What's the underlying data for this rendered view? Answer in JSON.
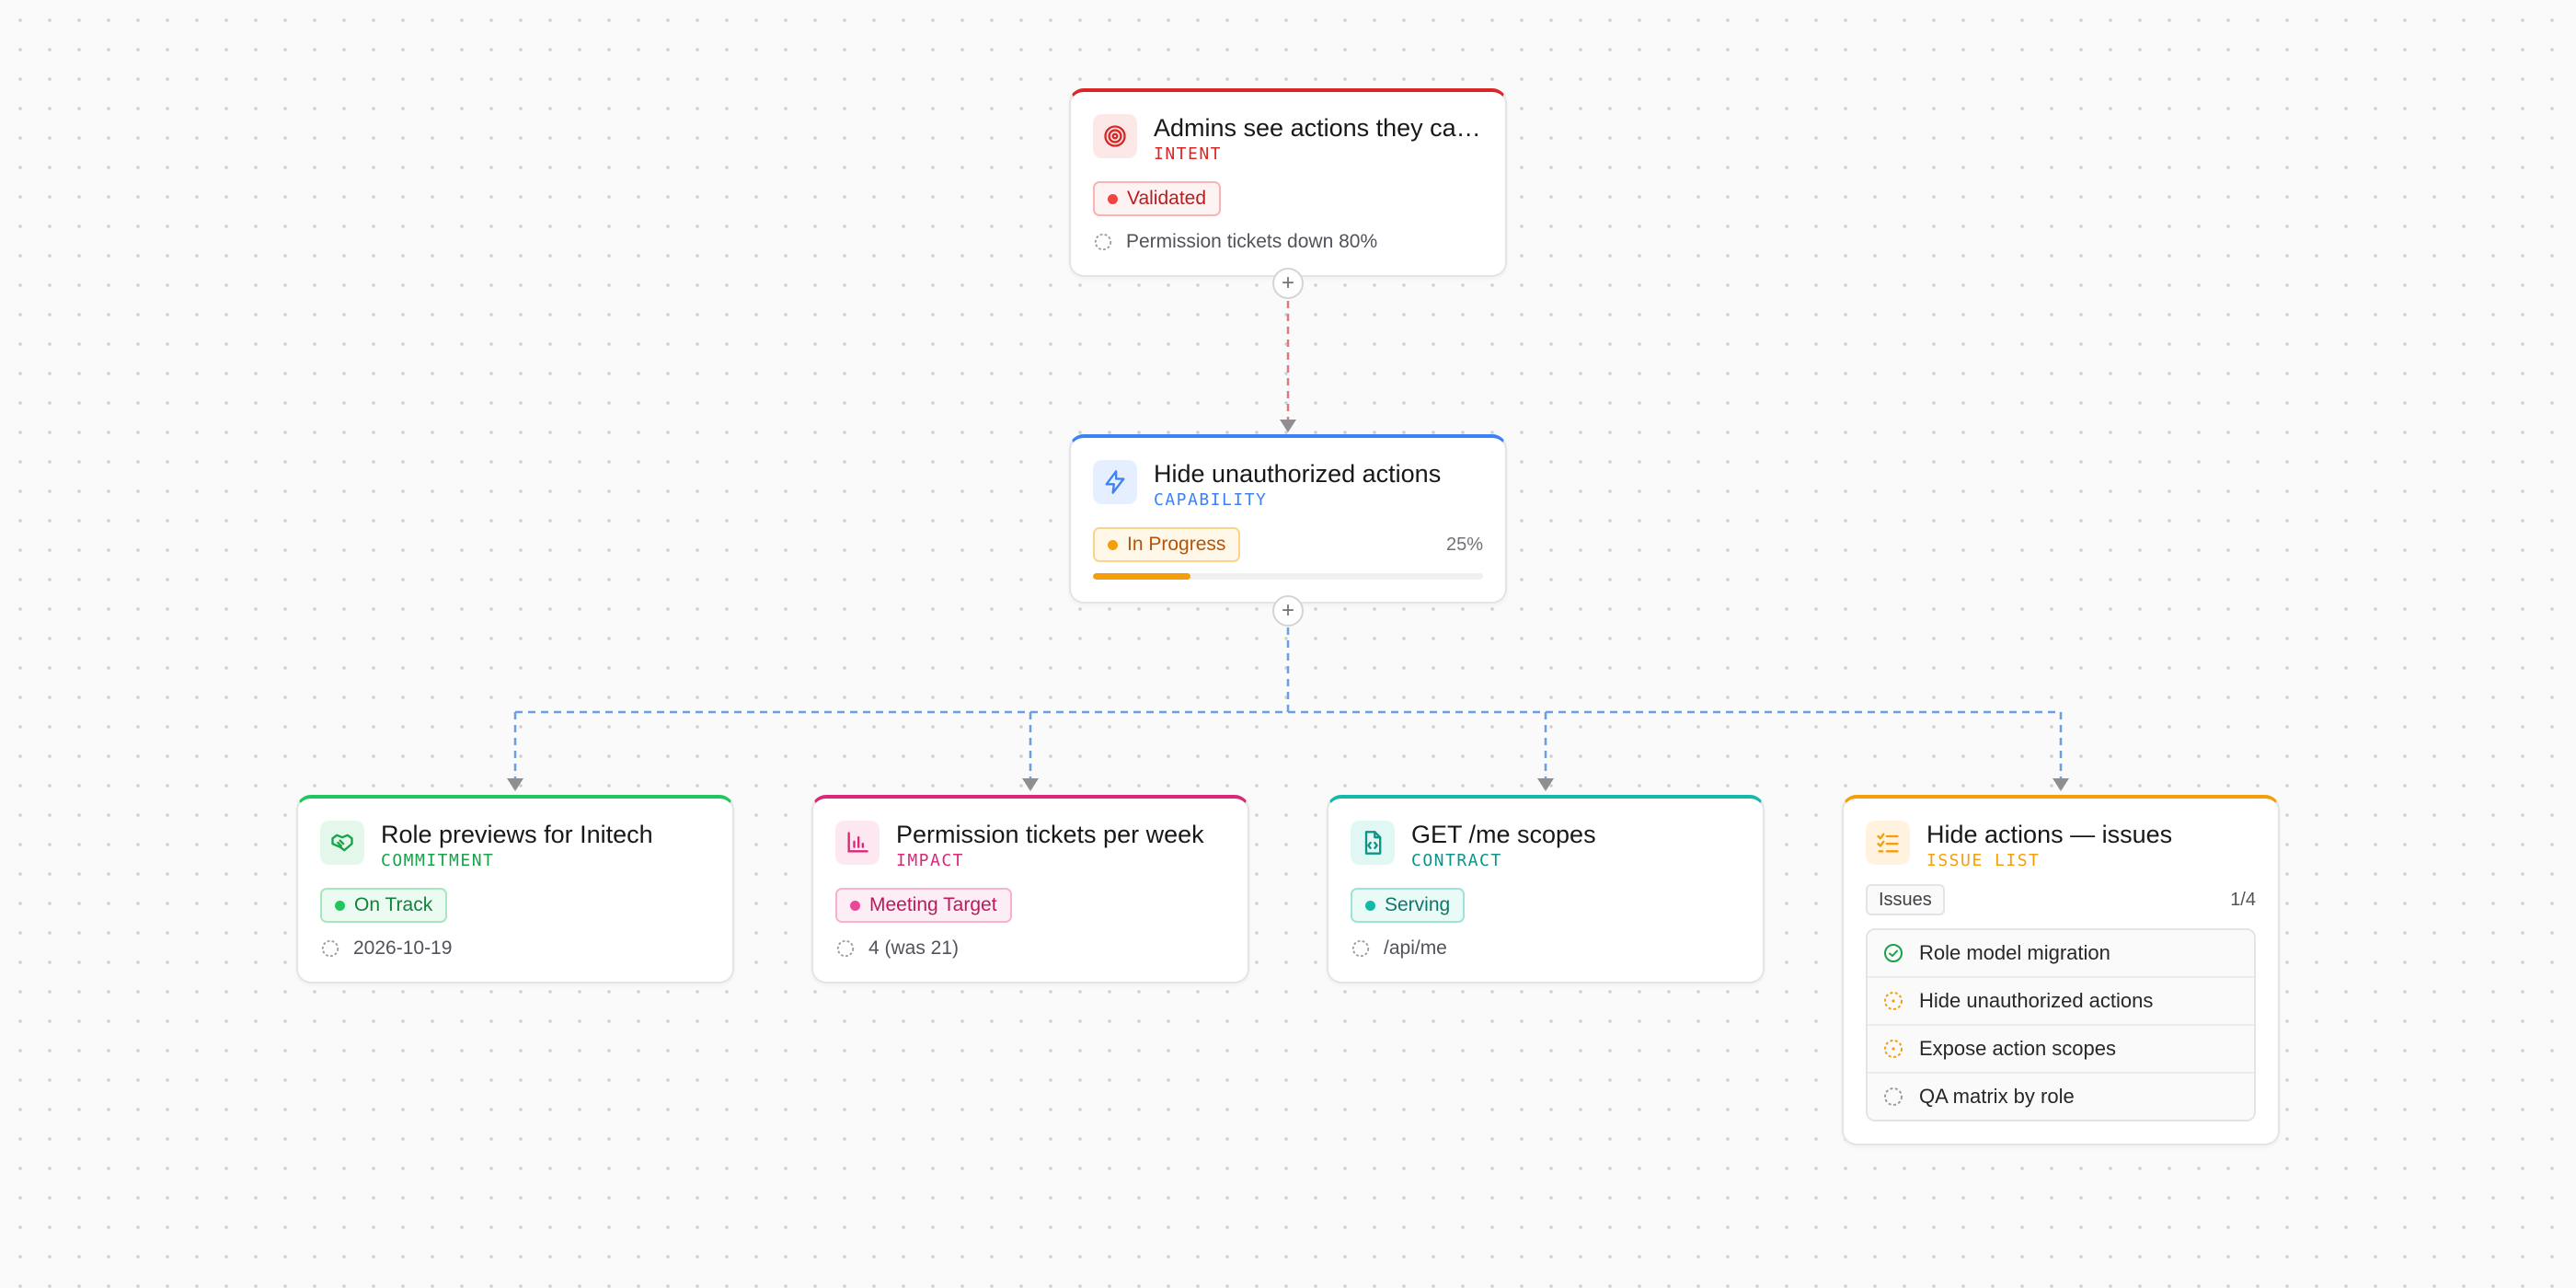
{
  "nodes": {
    "intent": {
      "title": "Admins see actions they can use",
      "kind": "INTENT",
      "status": "Validated",
      "meta": "Permission tickets down 80%",
      "icon": "target-icon",
      "accent": "#dc2626"
    },
    "capability": {
      "title": "Hide unauthorized actions",
      "kind": "CAPABILITY",
      "status": "In Progress",
      "progress_percent": 25,
      "progress_label": "25%",
      "icon": "lightning-icon",
      "accent": "#3b82f6"
    },
    "commitment": {
      "title": "Role previews for Initech",
      "kind": "COMMITMENT",
      "status": "On Track",
      "meta": "2026-10-19",
      "icon": "handshake-icon",
      "accent": "#22c55e"
    },
    "impact": {
      "title": "Permission tickets per week",
      "kind": "IMPACT",
      "status": "Meeting Target",
      "meta": "4 (was 21)",
      "icon": "bar-chart-icon",
      "accent": "#db2777"
    },
    "contract": {
      "title": "GET /me scopes",
      "kind": "CONTRACT",
      "status": "Serving",
      "meta": "/api/me",
      "icon": "code-file-icon",
      "accent": "#14b8a6"
    },
    "issue_list": {
      "title": "Hide actions — issues",
      "kind": "ISSUE LIST",
      "tag": "Issues",
      "count": "1/4",
      "icon": "checklist-icon",
      "accent": "#f59e0b",
      "issues": [
        {
          "label": "Role model migration",
          "state": "done"
        },
        {
          "label": "Hide unauthorized actions",
          "state": "in-progress"
        },
        {
          "label": "Expose action scopes",
          "state": "in-progress"
        },
        {
          "label": "QA matrix by role",
          "state": "todo"
        }
      ]
    }
  },
  "add_button_label": "+"
}
